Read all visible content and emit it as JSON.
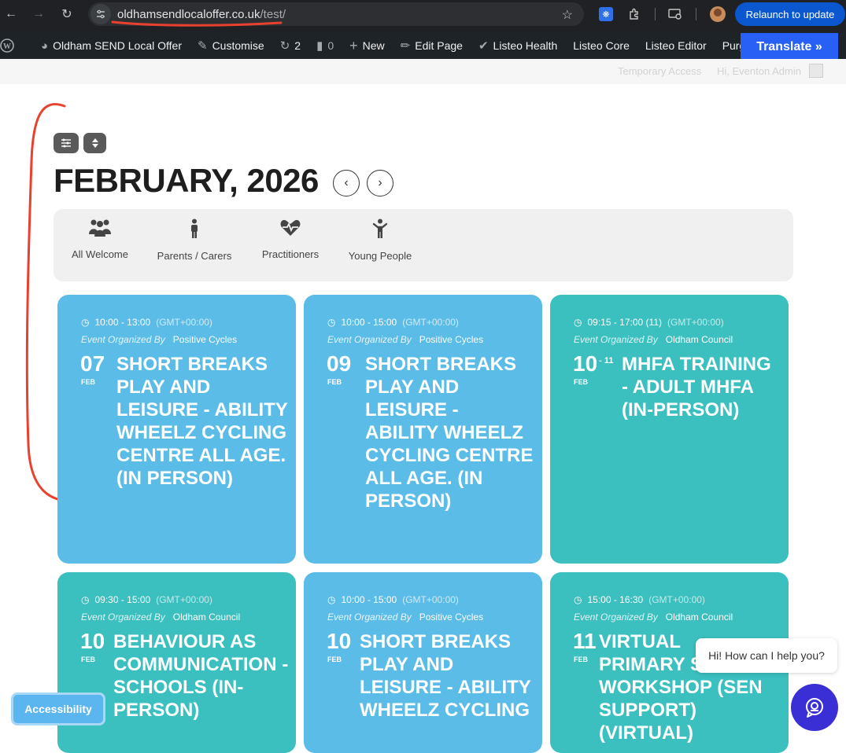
{
  "browser": {
    "url_domain": "oldhamsendlocaloffer.co.uk",
    "url_path": "/test/",
    "relaunch_label": "Relaunch to update",
    "icons": [
      "back-icon",
      "forward-icon",
      "reload-icon",
      "site-info-icon",
      "star-icon",
      "extension-icon",
      "puzzle-icon",
      "cast-icon",
      "profile-avatar"
    ]
  },
  "adminbar": {
    "site_name": "Oldham SEND Local Offer",
    "customise": "Customise",
    "updates_count": "2",
    "comments_count": "0",
    "new_label": "New",
    "edit_page": "Edit Page",
    "listeo_health": "Listeo Health",
    "listeo_core": "Listeo Core",
    "listeo_editor": "Listeo Editor",
    "purge": "Purge S",
    "translate": "Translate »"
  },
  "subbar": {
    "temporary_access": "Temporary Access",
    "greeting": "Hi, Eventon Admin"
  },
  "calendar": {
    "month_title": "FEBRUARY, 2026",
    "filters": [
      {
        "label": "All Welcome",
        "icon": "group-icon"
      },
      {
        "label": "Parents / Carers",
        "icon": "person-icon"
      },
      {
        "label": "Practitioners",
        "icon": "heartbeat-icon"
      },
      {
        "label": "Young People",
        "icon": "child-icon"
      }
    ]
  },
  "events": [
    {
      "time": "10:00 - 13:00",
      "tz": "(GMT+00:00)",
      "org_label": "Event Organized By",
      "organizer": "Positive Cycles",
      "day": "07",
      "day_end": "",
      "month": "FEB",
      "title": "SHORT BREAKS PLAY AND LEISURE - ABILITY WHEELZ CYCLING CENTRE ALL AGE. (IN PERSON)",
      "color": "#5bbce7"
    },
    {
      "time": "10:00 - 15:00",
      "tz": "(GMT+00:00)",
      "org_label": "Event Organized By",
      "organizer": "Positive Cycles",
      "day": "09",
      "day_end": "",
      "month": "FEB",
      "title": "SHORT BREAKS PLAY AND LEISURE - ABILITY WHEELZ CYCLING CENTRE ALL AGE. (IN PERSON)",
      "color": "#5bbce7"
    },
    {
      "time": "09:15 - 17:00 (11)",
      "tz": "(GMT+00:00)",
      "org_label": "Event Organized By",
      "organizer": "Oldham Council",
      "day": "10",
      "day_end": "- 11",
      "month": "FEB",
      "title": "MHFA TRAINING - ADULT MHFA (IN-PERSON)",
      "color": "#3bbfbf"
    },
    {
      "time": "09:30 - 15:00",
      "tz": "(GMT+00:00)",
      "org_label": "Event Organized By",
      "organizer": "Oldham Council",
      "day": "10",
      "day_end": "",
      "month": "FEB",
      "title": "BEHAVIOUR AS COMMUNICATION - SCHOOLS (IN-PERSON)",
      "color": "#3bbfbf"
    },
    {
      "time": "10:00 - 15:00",
      "tz": "(GMT+00:00)",
      "org_label": "Event Organized By",
      "organizer": "Positive Cycles",
      "day": "10",
      "day_end": "",
      "month": "FEB",
      "title": "SHORT BREAKS PLAY AND LEISURE - ABILITY WHEELZ CYCLING",
      "color": "#5bbce7"
    },
    {
      "time": "15:00 - 16:30",
      "tz": "(GMT+00:00)",
      "org_label": "Event Organized By",
      "organizer": "Oldham Council",
      "day": "11",
      "day_end": "",
      "month": "FEB",
      "title": "VIRTUAL PRIMARY S WORKSHOP (SEN SUPPORT) (VIRTUAL)",
      "color": "#3bbfbf"
    }
  ],
  "widgets": {
    "accessibility": "Accessibility",
    "chat_prompt": "Hi! How can I help you?"
  }
}
